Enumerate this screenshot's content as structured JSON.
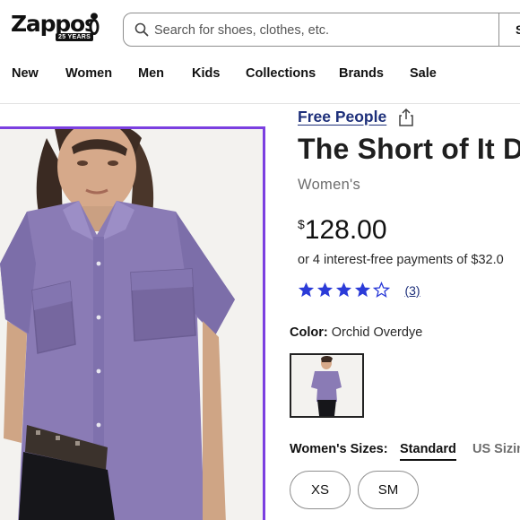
{
  "header": {
    "logo_text": "Zappos",
    "logo_badge": "25 YEARS",
    "search": {
      "placeholder": "Search for shoes, clothes, etc.",
      "value": "",
      "button_label": "S"
    }
  },
  "nav": {
    "items": [
      "New",
      "Women",
      "Men",
      "Kids",
      "Collections",
      "Brands",
      "Sale"
    ]
  },
  "product": {
    "brand": "Free People",
    "title": "The Short of It D",
    "gender": "Women's",
    "price_symbol": "$",
    "price_amount": "128.00",
    "installments": "or 4 interest-free payments of $32.0",
    "rating": {
      "stars": 4,
      "max": 5,
      "count": "(3)"
    },
    "color_label": "Color:",
    "color_value": "Orchid Overdye",
    "sizes_label": "Women's Sizes:",
    "size_system_selected": "Standard",
    "size_system_other": "US Sizin",
    "sizes": [
      "XS",
      "SM"
    ]
  },
  "colors": {
    "accent": "#7b3fe0",
    "brand_link": "#1d2f7a",
    "star": "#2b3bd8",
    "shirt": "#8a7bb5"
  },
  "icons": {
    "search": "search-icon",
    "share": "share-icon",
    "star": "star-icon"
  }
}
